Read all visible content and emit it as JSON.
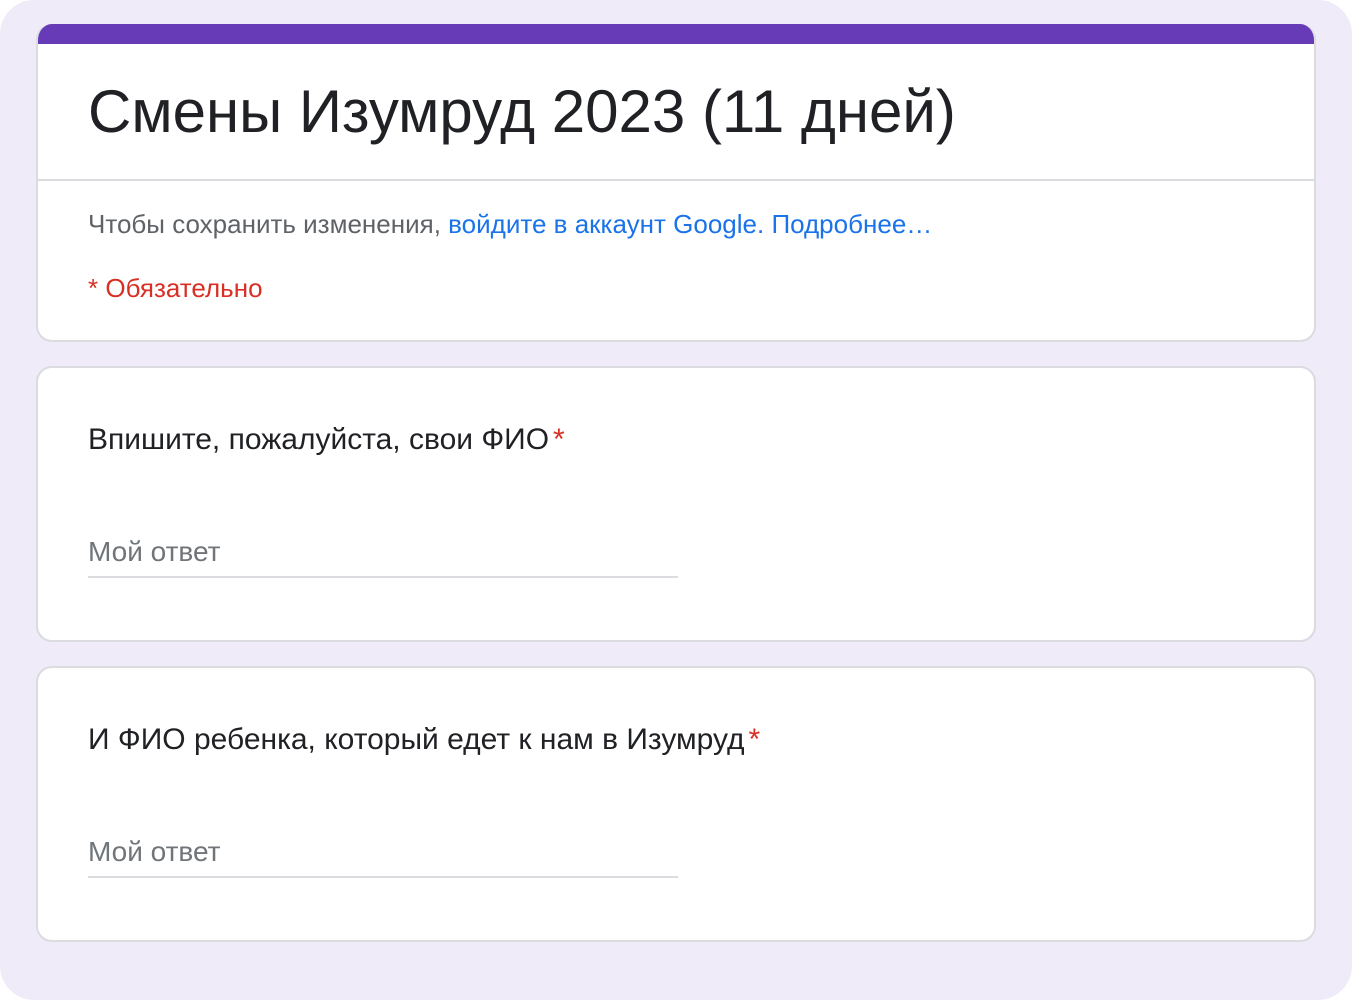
{
  "header": {
    "title": "Смены Изумруд 2023 (11 дней)",
    "signin_prefix": "Чтобы сохранить изменения, ",
    "signin_link": "войдите в аккаунт Google.",
    "learn_more": "Подробнее…",
    "required_note": "* Обязательно"
  },
  "questions": [
    {
      "label": "Впишите, пожалуйста, свои ФИО",
      "required_mark": "*",
      "placeholder": "Мой ответ"
    },
    {
      "label": "И ФИО ребенка, который едет к нам в Изумруд",
      "required_mark": "*",
      "placeholder": "Мой ответ"
    }
  ],
  "colors": {
    "accent": "#673ab7",
    "background": "#efebf8",
    "link": "#1a73e8",
    "required": "#d93025"
  }
}
